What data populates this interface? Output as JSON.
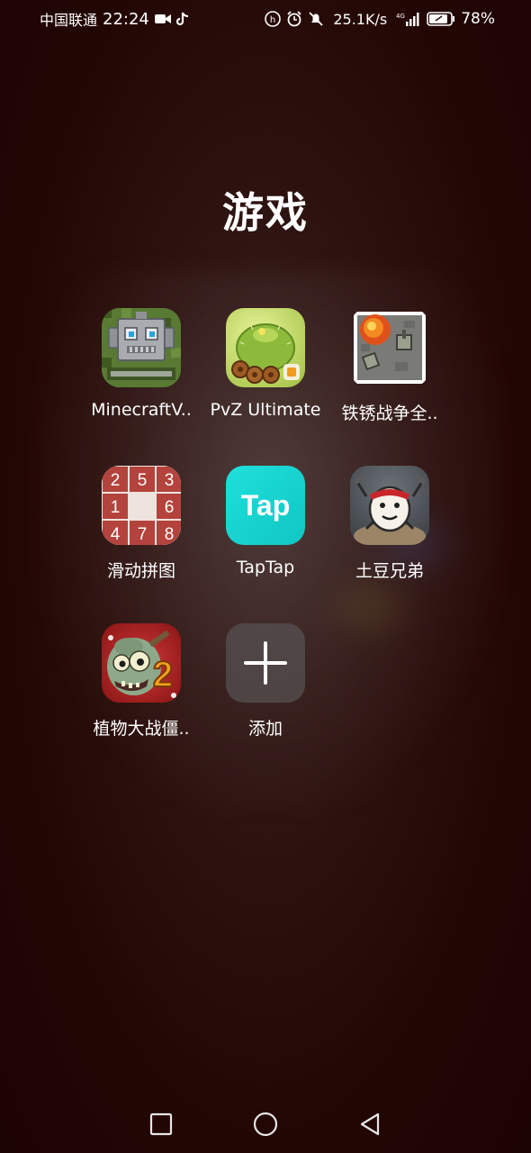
{
  "status_bar": {
    "carrier": "中国联通",
    "time": "22:24",
    "net_speed": "25.1K/s",
    "network_type": "4G",
    "battery_percent": "78%",
    "icons": [
      "video-icon",
      "tiktok-icon",
      "hd-icon",
      "alarm-icon",
      "mute-icon",
      "signal-icon",
      "battery-icon"
    ]
  },
  "folder": {
    "title": "游戏",
    "apps": [
      {
        "label": "MinecraftV..",
        "icon": "minecraft-robot-icon"
      },
      {
        "label": "PvZ Ultimate",
        "icon": "pvz-ultimate-icon"
      },
      {
        "label": "铁锈战争全..",
        "icon": "rusted-warfare-icon"
      },
      {
        "label": "滑动拼图",
        "icon": "sliding-puzzle-icon"
      },
      {
        "label": "TapTap",
        "icon": "taptap-icon"
      },
      {
        "label": "土豆兄弟",
        "icon": "brotato-icon"
      },
      {
        "label": "植物大战僵..",
        "icon": "pvz2-icon"
      },
      {
        "label": "添加",
        "icon": "add-icon"
      }
    ],
    "puzzle_numbers": [
      "2",
      "5",
      "3",
      "1",
      "",
      "6",
      "4",
      "7",
      "8"
    ],
    "taptap_text": "Tap"
  },
  "nav_bar": {
    "buttons": [
      "recents",
      "home",
      "back"
    ]
  },
  "colors": {
    "taptap_accent": "#18d4d0",
    "puzzle_tile": "#b3433c"
  }
}
